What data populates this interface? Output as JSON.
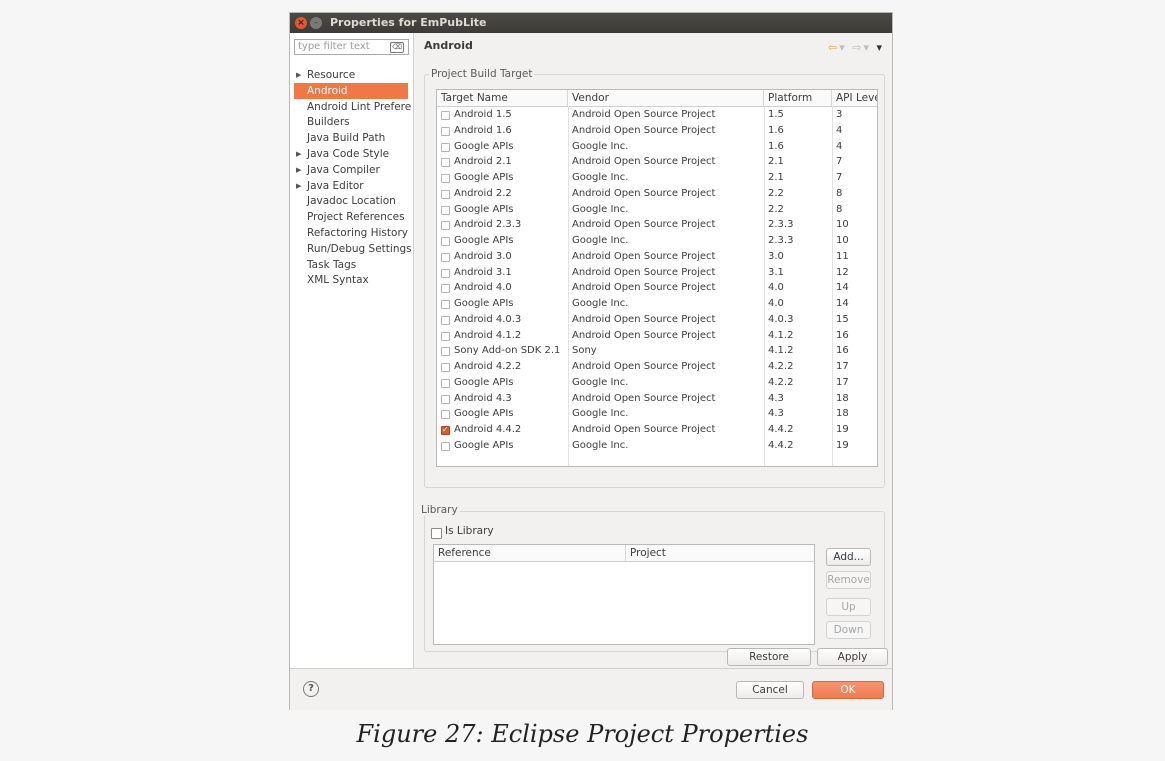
{
  "window": {
    "title": "Properties for EmPubLite",
    "close_glyph": "×",
    "min_glyph": "–"
  },
  "left_pane": {
    "filter_placeholder": "type filter text",
    "filter_clear_glyph": "⌫",
    "items": [
      {
        "label": "Resource",
        "expandable": true,
        "selected": false
      },
      {
        "label": "Android",
        "expandable": false,
        "selected": true
      },
      {
        "label": "Android Lint Preferences",
        "expandable": false,
        "selected": false
      },
      {
        "label": "Builders",
        "expandable": false,
        "selected": false
      },
      {
        "label": "Java Build Path",
        "expandable": false,
        "selected": false
      },
      {
        "label": "Java Code Style",
        "expandable": true,
        "selected": false
      },
      {
        "label": "Java Compiler",
        "expandable": true,
        "selected": false
      },
      {
        "label": "Java Editor",
        "expandable": true,
        "selected": false
      },
      {
        "label": "Javadoc Location",
        "expandable": false,
        "selected": false
      },
      {
        "label": "Project References",
        "expandable": false,
        "selected": false
      },
      {
        "label": "Refactoring History",
        "expandable": false,
        "selected": false
      },
      {
        "label": "Run/Debug Settings",
        "expandable": false,
        "selected": false
      },
      {
        "label": "Task Tags",
        "expandable": false,
        "selected": false
      },
      {
        "label": "XML Syntax",
        "expandable": false,
        "selected": false
      }
    ],
    "expand_glyph": "▶"
  },
  "page": {
    "title": "Android",
    "nav": {
      "back": "⇦",
      "dropdown": "▾",
      "forward": "⇨",
      "menu": "▾"
    },
    "build_target": {
      "group_label": "Project Build Target",
      "columns": [
        "Target Name",
        "Vendor",
        "Platform",
        "API Level"
      ],
      "rows": [
        {
          "name": "Android 1.5",
          "vendor": "Android Open Source Project",
          "platform": "1.5",
          "api": "3",
          "checked": false
        },
        {
          "name": "Android 1.6",
          "vendor": "Android Open Source Project",
          "platform": "1.6",
          "api": "4",
          "checked": false
        },
        {
          "name": "Google APIs",
          "vendor": "Google Inc.",
          "platform": "1.6",
          "api": "4",
          "checked": false
        },
        {
          "name": "Android 2.1",
          "vendor": "Android Open Source Project",
          "platform": "2.1",
          "api": "7",
          "checked": false
        },
        {
          "name": "Google APIs",
          "vendor": "Google Inc.",
          "platform": "2.1",
          "api": "7",
          "checked": false
        },
        {
          "name": "Android 2.2",
          "vendor": "Android Open Source Project",
          "platform": "2.2",
          "api": "8",
          "checked": false
        },
        {
          "name": "Google APIs",
          "vendor": "Google Inc.",
          "platform": "2.2",
          "api": "8",
          "checked": false
        },
        {
          "name": "Android 2.3.3",
          "vendor": "Android Open Source Project",
          "platform": "2.3.3",
          "api": "10",
          "checked": false
        },
        {
          "name": "Google APIs",
          "vendor": "Google Inc.",
          "platform": "2.3.3",
          "api": "10",
          "checked": false
        },
        {
          "name": "Android 3.0",
          "vendor": "Android Open Source Project",
          "platform": "3.0",
          "api": "11",
          "checked": false
        },
        {
          "name": "Android 3.1",
          "vendor": "Android Open Source Project",
          "platform": "3.1",
          "api": "12",
          "checked": false
        },
        {
          "name": "Android 4.0",
          "vendor": "Android Open Source Project",
          "platform": "4.0",
          "api": "14",
          "checked": false
        },
        {
          "name": "Google APIs",
          "vendor": "Google Inc.",
          "platform": "4.0",
          "api": "14",
          "checked": false
        },
        {
          "name": "Android 4.0.3",
          "vendor": "Android Open Source Project",
          "platform": "4.0.3",
          "api": "15",
          "checked": false
        },
        {
          "name": "Android 4.1.2",
          "vendor": "Android Open Source Project",
          "platform": "4.1.2",
          "api": "16",
          "checked": false
        },
        {
          "name": "Sony Add-on SDK 2.1",
          "vendor": "Sony",
          "platform": "4.1.2",
          "api": "16",
          "checked": false
        },
        {
          "name": "Android 4.2.2",
          "vendor": "Android Open Source Project",
          "platform": "4.2.2",
          "api": "17",
          "checked": false
        },
        {
          "name": "Google APIs",
          "vendor": "Google Inc.",
          "platform": "4.2.2",
          "api": "17",
          "checked": false
        },
        {
          "name": "Android 4.3",
          "vendor": "Android Open Source Project",
          "platform": "4.3",
          "api": "18",
          "checked": false
        },
        {
          "name": "Google APIs",
          "vendor": "Google Inc.",
          "platform": "4.3",
          "api": "18",
          "checked": false
        },
        {
          "name": "Android 4.4.2",
          "vendor": "Android Open Source Project",
          "platform": "4.4.2",
          "api": "19",
          "checked": true
        },
        {
          "name": "Google APIs",
          "vendor": "Google Inc.",
          "platform": "4.4.2",
          "api": "19",
          "checked": false
        }
      ]
    },
    "library": {
      "group_label": "Library",
      "is_library_label": "Is Library",
      "is_library_checked": false,
      "columns": [
        "Reference",
        "Project"
      ],
      "buttons": {
        "add": "Add...",
        "remove": "Remove",
        "up": "Up",
        "down": "Down"
      }
    },
    "restore_defaults": "Restore Defaults",
    "apply": "Apply"
  },
  "footer": {
    "help_glyph": "?",
    "cancel": "Cancel",
    "ok": "OK"
  },
  "caption": "Figure 27: Eclipse Project Properties",
  "colors": {
    "accent": "#f07746",
    "titlebar": "#3c3b37",
    "close": "#e2572e"
  }
}
